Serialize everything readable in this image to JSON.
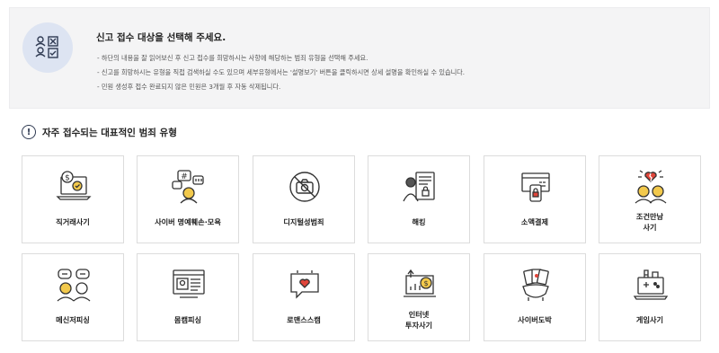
{
  "notice": {
    "icon": "user-checklist-icon",
    "title": "신고 접수 대상을 선택해 주세요.",
    "lines": [
      "-  하단의 내용을 잘 읽어보신 후 신고 접수를 희망하시는 사항에 해당하는 범죄 유형을 선택해 주세요.",
      "-  신고를 희망하시는 유형을 직접 검색하실 수도 있으며 세부유형에서는 '설명보기' 버튼을 클릭하시면 상세 설명을 확인하실 수 있습니다.",
      "-  민원 생성후 접수 완료되지 않은 민원은 3개월 후 자동 삭제됩니다."
    ]
  },
  "section": {
    "icon_glyph": "!",
    "title": "자주 접수되는 대표적인 범죄 유형"
  },
  "crime_types": [
    {
      "label": "직거래사기",
      "icon": "laptop-money-icon"
    },
    {
      "label": "사이버 명예훼손·모욕",
      "icon": "speech-person-icon"
    },
    {
      "label": "디지털성범죄",
      "icon": "no-camera-icon"
    },
    {
      "label": "해킹",
      "icon": "hacker-icon"
    },
    {
      "label": "소액결제",
      "icon": "phone-payment-icon"
    },
    {
      "label": "조건만남\n사기",
      "icon": "broken-heart-couple-icon"
    },
    {
      "label": "메신저피싱",
      "icon": "messenger-people-icon"
    },
    {
      "label": "몸캠피싱",
      "icon": "webcam-window-icon"
    },
    {
      "label": "로맨스스캠",
      "icon": "heart-chat-icon"
    },
    {
      "label": "인터넷\n투자사기",
      "icon": "investment-chart-icon"
    },
    {
      "label": "사이버도박",
      "icon": "cards-hand-icon"
    },
    {
      "label": "게임사기",
      "icon": "game-laptop-icon"
    }
  ],
  "colors": {
    "notice_bg": "#f4f4f5",
    "badge_bg": "#dde4f2",
    "icon_stroke": "#333333",
    "accent_blue": "#2b6fd8",
    "accent_red": "#e0453a",
    "accent_yellow": "#f2c94c"
  }
}
